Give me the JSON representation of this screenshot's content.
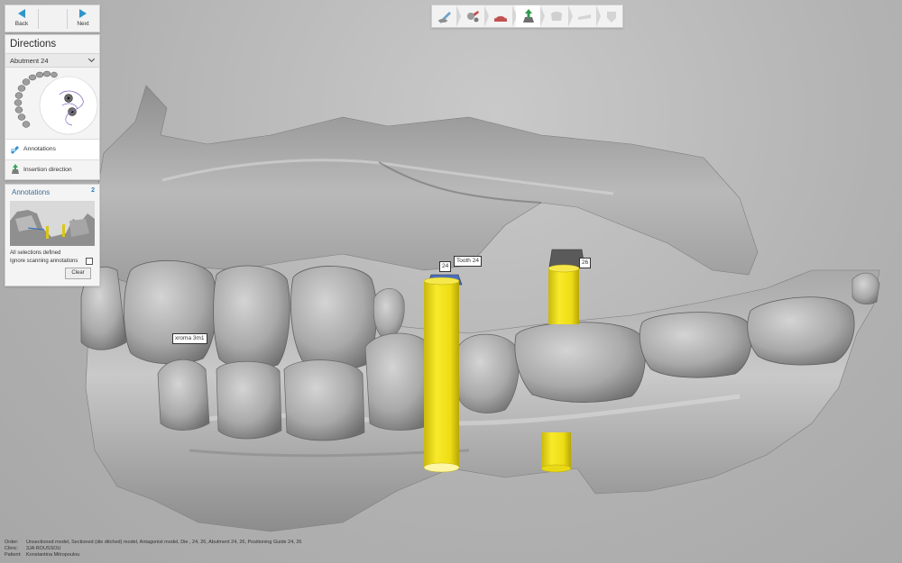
{
  "nav": {
    "back_label": "Back",
    "next_label": "Next"
  },
  "directions": {
    "title": "Directions",
    "dropdown_value": "Abutment 24",
    "steps": [
      {
        "label": "Annotations",
        "icon": "annotation-pen-icon"
      },
      {
        "label": "Insertion direction",
        "icon": "insertion-direction-icon"
      }
    ]
  },
  "annotations": {
    "title": "Annotations",
    "count": "2",
    "status": "All selections defined",
    "ignore_label": "Ignore scanning annotations",
    "ignore_checked": false,
    "clear_label": "Clear"
  },
  "toolbar": {
    "steps": [
      {
        "name": "order-step",
        "icon": "tooth-pen-icon",
        "state": "done"
      },
      {
        "name": "scan-step",
        "icon": "scanner-icon",
        "state": "done"
      },
      {
        "name": "model-step",
        "icon": "jaw-model-icon",
        "state": "done"
      },
      {
        "name": "directions-step",
        "icon": "insertion-arrow-icon",
        "state": "active"
      },
      {
        "name": "design-step",
        "icon": "crown-icon",
        "state": "pending"
      },
      {
        "name": "guide-step",
        "icon": "guide-icon",
        "state": "pending"
      },
      {
        "name": "export-step",
        "icon": "export-icon",
        "state": "pending"
      }
    ]
  },
  "viewport": {
    "callouts": {
      "shade": "хroma 3m1",
      "implant_24": "24",
      "tooth_24": "Tooth 24",
      "implant_26": "26"
    },
    "implant_color": "#f4e21c"
  },
  "footer": {
    "order_key": "Order:",
    "order_value": "Unsectioned model, Sectioned (die ditched) model, Antagonist model, Die , 24, 26, Abutment 24, 26, Positioning Guide 24, 26",
    "clinic_key": "Clinic:",
    "clinic_value": "3JA ROUSSOU",
    "patient_key": "Patient:",
    "patient_value": "Konstantina Mitropoulou"
  }
}
